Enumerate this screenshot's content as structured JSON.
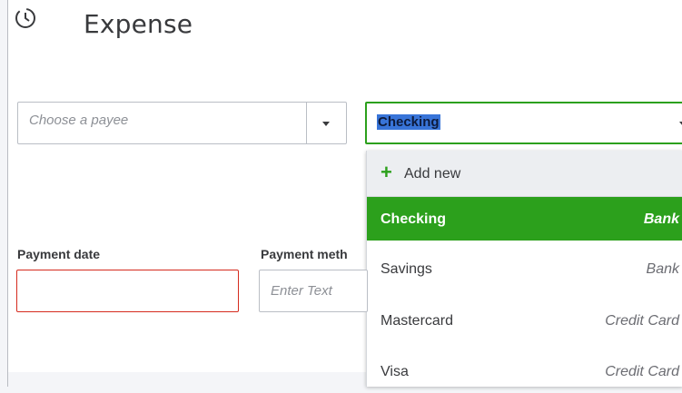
{
  "header": {
    "title": "Expense",
    "icon": "recurring-clock-icon"
  },
  "payee": {
    "placeholder": "Choose a payee"
  },
  "account": {
    "value": "Checking"
  },
  "dropdown": {
    "add_new_label": "Add new",
    "options": [
      {
        "name": "Checking",
        "type": "Bank",
        "selected": true
      },
      {
        "name": "Savings",
        "type": "Bank"
      },
      {
        "name": "Mastercard",
        "type": "Credit Card"
      },
      {
        "name": "Visa",
        "type": "Credit Card"
      }
    ]
  },
  "form": {
    "payment_date_label": "Payment date",
    "payment_method_label": "Payment meth",
    "payment_method_placeholder": "Enter Text"
  },
  "colors": {
    "accent": "#2ca01c",
    "error": "#d52b1e",
    "selection": "#3874d8"
  }
}
